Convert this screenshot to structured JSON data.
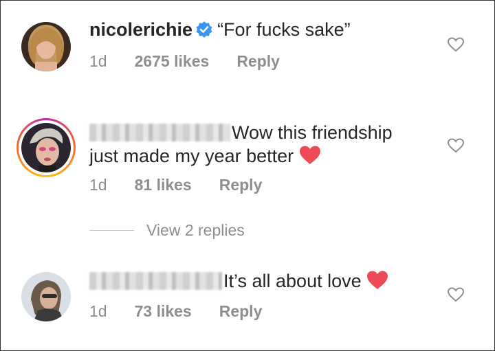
{
  "comments": [
    {
      "username": "nicolerichie",
      "verified": true,
      "text": "“For fucks sake”",
      "time": "1d",
      "likes": "2675 likes",
      "reply": "Reply"
    },
    {
      "username_blurred": true,
      "story_ring": true,
      "text_line1": "Wow this friendship",
      "text_line2": "just made my year better",
      "emoji": "❤️",
      "time": "1d",
      "likes": "81 likes",
      "reply": "Reply"
    },
    {
      "username_blurred": true,
      "text": "It’s all about love",
      "emoji": "❤️",
      "time": "1d",
      "likes": "73 likes",
      "reply": "Reply"
    }
  ],
  "view_replies": "View 2 replies",
  "icons": {
    "verified": "verified-badge-icon",
    "like": "heart-outline-icon",
    "emoji_heart": "red-heart-icon"
  },
  "colors": {
    "verified_blue": "#3897f0",
    "heart_red": "#ed4956",
    "meta_gray": "#8e8e8e"
  }
}
